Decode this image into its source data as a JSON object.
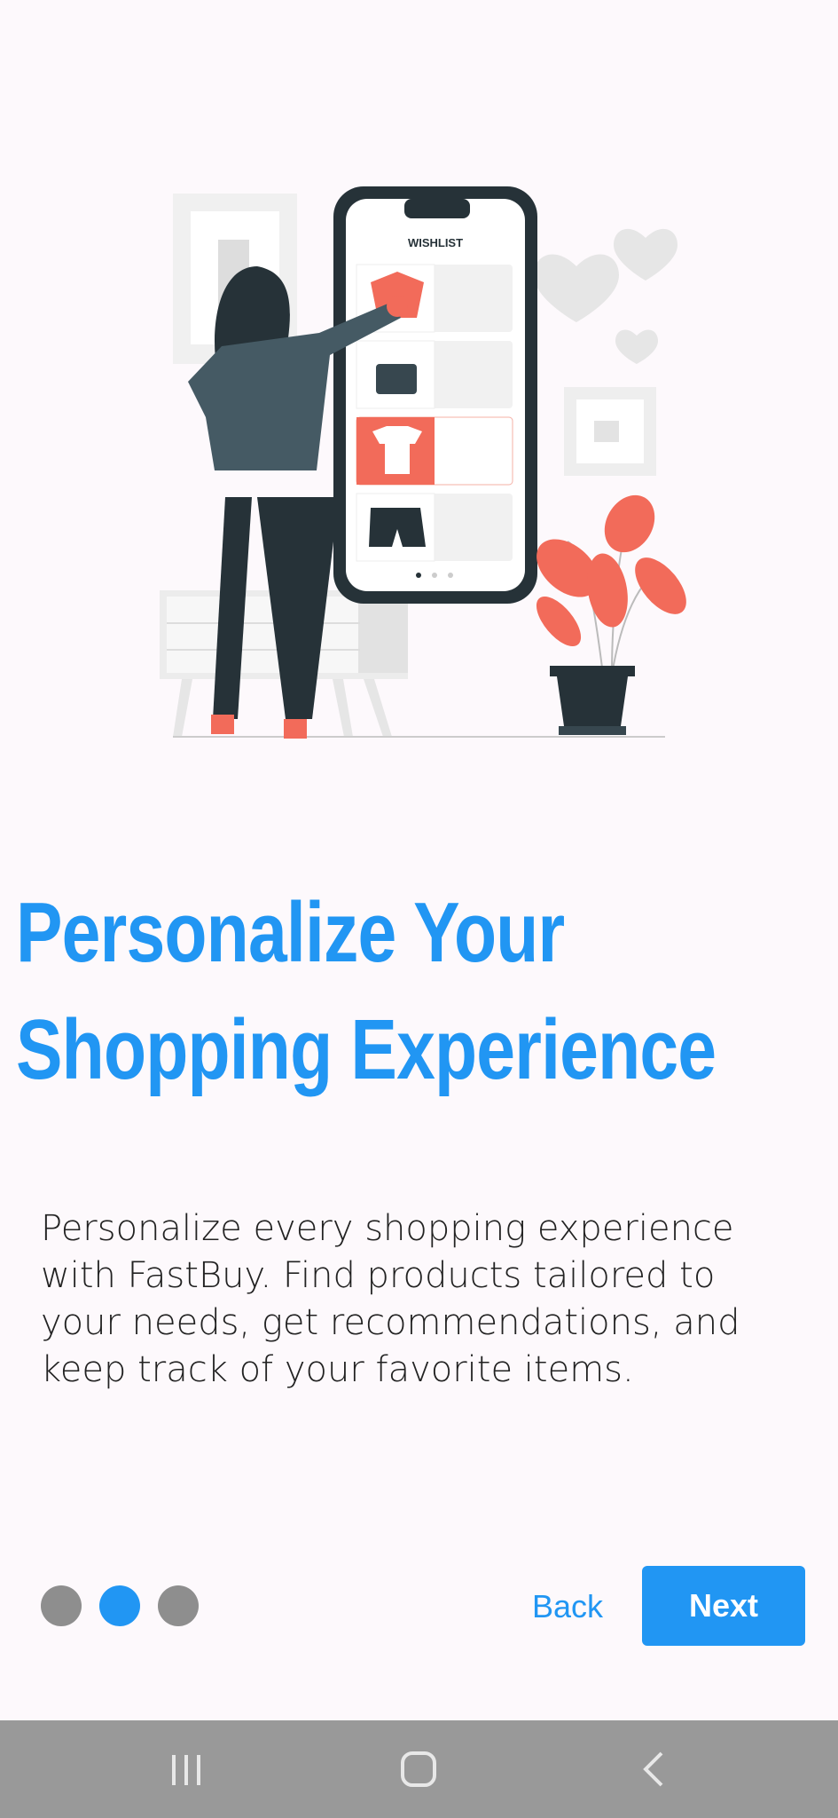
{
  "onboarding": {
    "title_line1": "Personalize Your",
    "title_line2": "Shopping Experience",
    "description": "Personalize every shopping experience with FastBuy. Find products tailored to your needs, get recommendations, and keep track of your favorite items.",
    "page_indicator": {
      "total": 3,
      "active_index": 1
    },
    "back_label": "Back",
    "next_label": "Next"
  },
  "illustration": {
    "phone_header": "WISHLIST",
    "items": [
      "blouse-icon",
      "handbag-icon",
      "tshirt-icon",
      "shorts-icon"
    ]
  },
  "system_nav": {
    "icons": [
      "recent-apps-icon",
      "home-icon",
      "back-icon"
    ]
  },
  "colors": {
    "accent": "#2196f3",
    "coral": "#f26b5a",
    "dark": "#263238",
    "background": "#fdf9fc"
  }
}
